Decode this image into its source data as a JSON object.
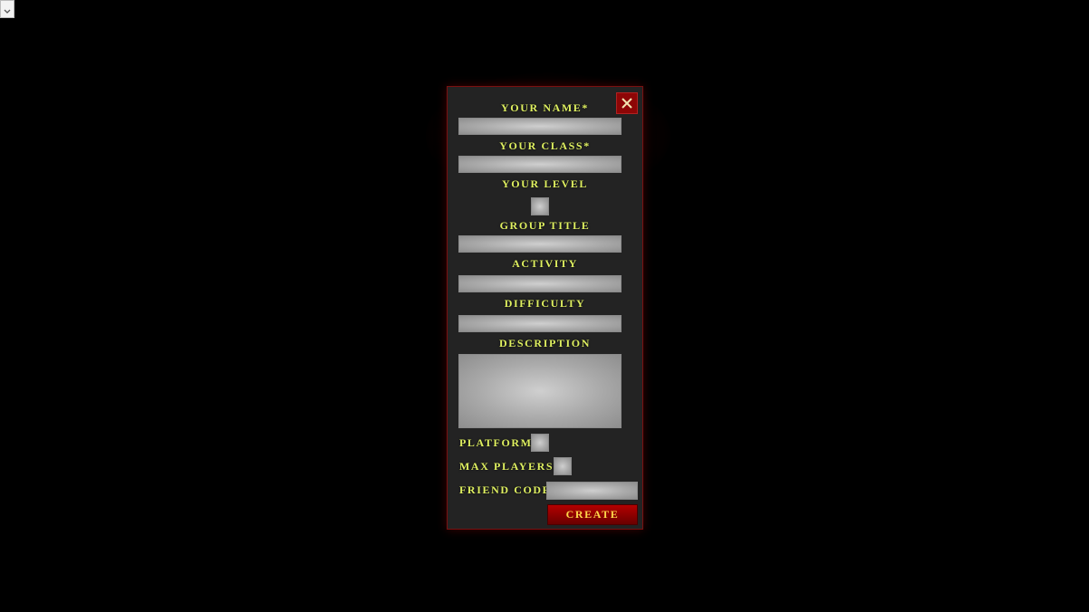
{
  "dialog": {
    "close_icon": "close-icon",
    "fields": {
      "name_label": "YOUR NAME*",
      "class_label": "YOUR CLASS*",
      "level_label": "YOUR LEVEL",
      "group_title_label": "GROUP TITLE",
      "activity_label": "ACTIVITY",
      "difficulty_label": "DIFFICULTY",
      "description_label": "DESCRIPTION",
      "platform_label": "PLATFORM",
      "max_players_label": "MAX PLAYERS",
      "friend_code_label": "FRIEND CODE"
    },
    "create_label": "CREATE"
  },
  "top_left_select": {
    "icon": "chevron-down-icon"
  },
  "colors": {
    "background": "#000000",
    "panel": "#232323",
    "panel_border": "#7a1010",
    "label_text": "#dff060",
    "button_red": "#b40000",
    "button_text": "#ffd84a"
  }
}
